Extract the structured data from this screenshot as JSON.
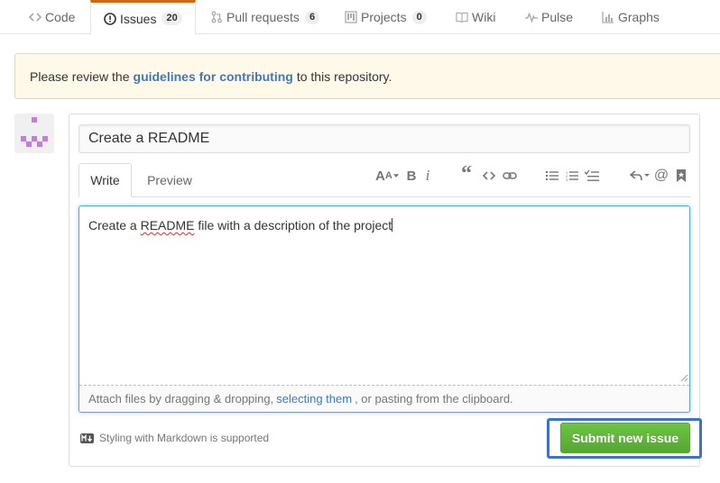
{
  "nav": {
    "tabs": [
      {
        "label": "Code",
        "icon": "code-icon"
      },
      {
        "label": "Issues",
        "icon": "issue-opened-icon",
        "count": "20",
        "selected": true
      },
      {
        "label": "Pull requests",
        "icon": "git-pull-request-icon",
        "count": "6"
      },
      {
        "label": "Projects",
        "icon": "project-icon",
        "count": "0"
      },
      {
        "label": "Wiki",
        "icon": "book-icon"
      },
      {
        "label": "Pulse",
        "icon": "pulse-icon"
      },
      {
        "label": "Graphs",
        "icon": "graph-icon"
      }
    ]
  },
  "flash": {
    "prefix": "Please review the",
    "link": "guidelines for contributing",
    "suffix": "to this repository."
  },
  "issue_form": {
    "title_value": "Create a README",
    "write_tab": "Write",
    "preview_tab": "Preview",
    "toolbar": [
      "header-icon",
      "bold-icon",
      "italic-icon",
      "quote-icon",
      "code-icon",
      "link-icon",
      "unordered-list-icon",
      "ordered-list-icon",
      "task-list-icon",
      "reply-icon",
      "mention-icon",
      "bookmark-icon"
    ],
    "body_before": "Create a ",
    "body_misspelled": "README",
    "body_after": " file with a description of the project",
    "drop_prefix": "Attach files by dragging & dropping,",
    "drop_link": "selecting them",
    "drop_suffix": ", or pasting from the clipboard.",
    "markdown_note": "Styling with Markdown is supported",
    "submit_label": "Submit new issue"
  },
  "colors": {
    "accent_tab": "#d26911",
    "link": "#4078c0",
    "submit_green": "#6cc644",
    "focus_ring": "#3d72c8",
    "avatar": "#c77be0"
  }
}
